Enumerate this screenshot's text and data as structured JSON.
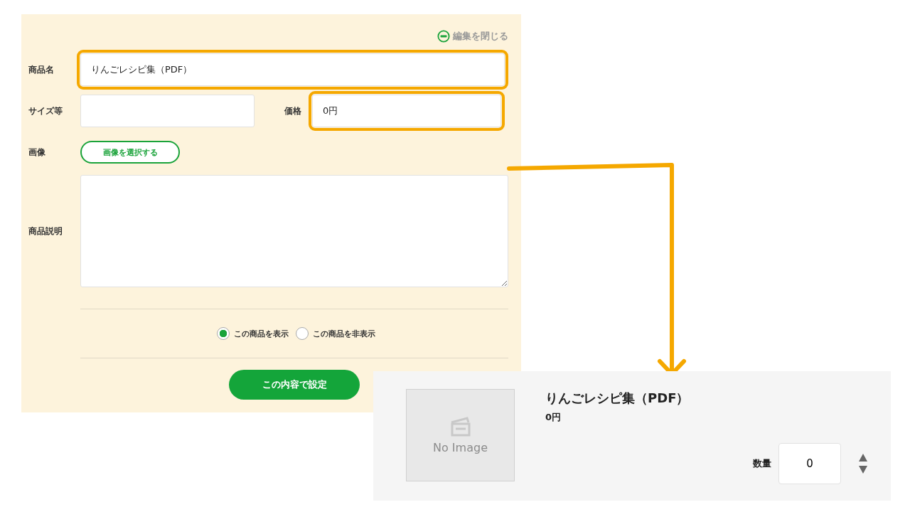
{
  "close_link": {
    "label": "編集を閉じる"
  },
  "name_field": {
    "label": "商品名",
    "value": "りんごレシピ集（PDF）",
    "highlighted": true
  },
  "size_field": {
    "label": "サイズ等",
    "highlighted": false
  },
  "price_field": {
    "label": "価格",
    "value": "0円",
    "highlighted": true
  },
  "image": {
    "label": "画像",
    "button": "画像を選択する"
  },
  "description": {
    "label": "商品説明"
  },
  "visibility": [
    {
      "label": "この商品を表示",
      "selected": true
    },
    {
      "label": "この商品を非表示",
      "selected": false
    }
  ],
  "submit": "この内容で設定",
  "preview": {
    "image_text": "No Image",
    "name": "りんごレシピ集（PDF）",
    "price": "0円",
    "quantity_label": "数量",
    "quantity": "0"
  }
}
